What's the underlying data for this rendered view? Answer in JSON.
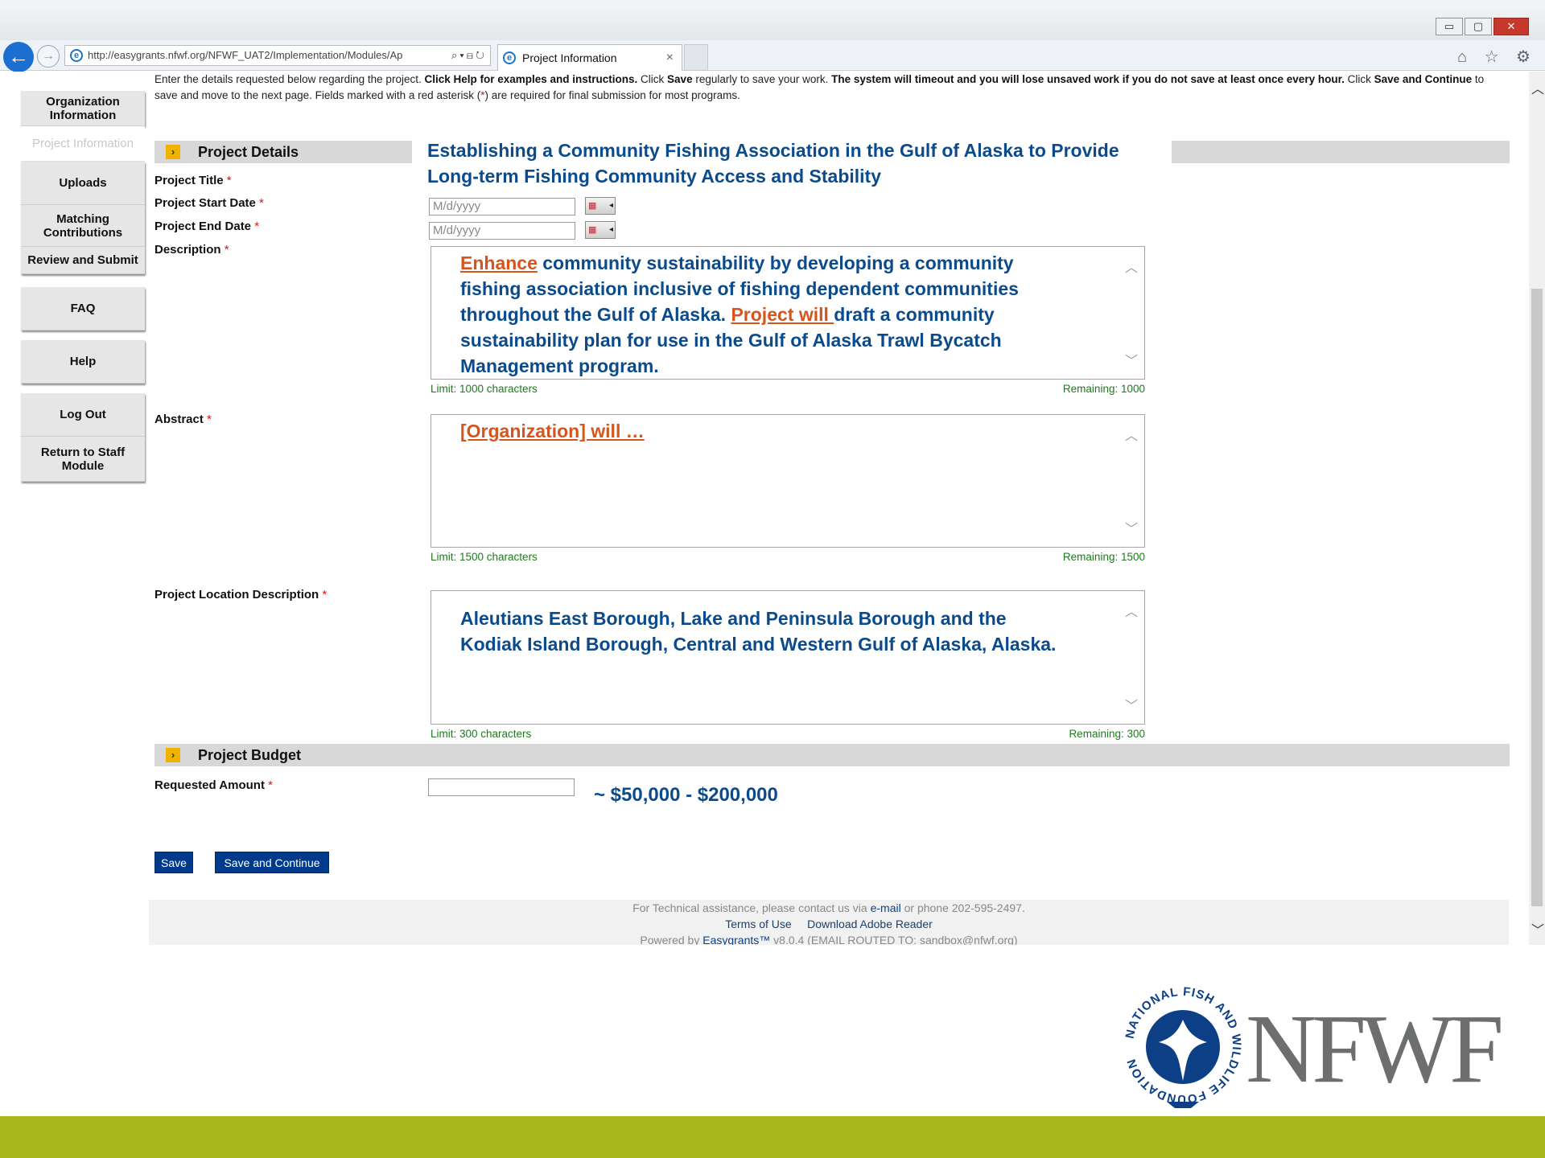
{
  "browser": {
    "url": "http://easygrants.nfwf.org/NFWF_UAT2/Implementation/Modules/Ap",
    "tab_label": "Project Information",
    "tab_close": "×",
    "window_buttons": [
      "▭",
      "▢",
      "✕"
    ],
    "toolbar_icons": "⌂ ☆ ⚙"
  },
  "sidebar": {
    "items": [
      {
        "label": "Organization Information"
      },
      {
        "label": "Project Information"
      },
      {
        "label": "Uploads"
      },
      {
        "label": "Matching Contributions"
      },
      {
        "label": "Review and Submit"
      },
      {
        "label": "FAQ"
      },
      {
        "label": "Help"
      },
      {
        "label": "Log Out"
      },
      {
        "label": "Return to Staff Module"
      }
    ]
  },
  "intro": {
    "p1": "Enter the details requested below regarding the project. ",
    "b1": "Click Help for examples and instructions.",
    "p2": " Click ",
    "b2": "Save",
    "p3": " regularly to save your work. ",
    "b3": "The system will timeout and you will lose unsaved work if you do not save at least once every hour.",
    "p4": " Click ",
    "b4": "Save and Continue",
    "p5": " to save and move to the next page. Fields marked with a red asterisk (",
    "ast": "*",
    "p6": ") are required for final submission for most programs."
  },
  "details": {
    "section_title": "Project Details",
    "title_label": "Project Title",
    "title_value": "Establishing a Community Fishing Association in the Gulf of Alaska to Provide Long-term Fishing Community Access and Stability",
    "start_label": "Project Start Date",
    "end_label": "Project End Date",
    "date_placeholder": "M/d/yyyy",
    "description_label": "Description",
    "description_orange1": "Enhance",
    "description_part1": " community sustainability by developing a community fishing association inclusive of fishing dependent communities throughout the Gulf of Alaska. ",
    "description_orange2": "Project will ",
    "description_part2": "draft a community sustainability plan for use in the Gulf of Alaska Trawl Bycatch Management program.",
    "description_limit": "Limit: 1000 characters",
    "description_remaining": "Remaining: 1000",
    "abstract_label": "Abstract",
    "abstract_value": "[Organization] will …",
    "abstract_limit": "Limit: 1500 characters",
    "abstract_remaining": "Remaining: 1500",
    "location_label": "Project Location Description",
    "location_value": "Aleutians East Borough, Lake and Peninsula Borough and the Kodiak Island Borough, Central and Western Gulf of Alaska, Alaska.",
    "location_limit": "Limit: 300 characters",
    "location_remaining": "Remaining: 300",
    "required_mark": "*"
  },
  "budget": {
    "section_title": "Project Budget",
    "amount_label": "Requested Amount",
    "amount_value": "",
    "amount_note": "~ $50,000 - $200,000"
  },
  "buttons": {
    "save": "Save",
    "save_continue": "Save and Continue"
  },
  "footer": {
    "assist_pre": "For Technical assistance, please contact us via ",
    "assist_link": "e-mail",
    "assist_post": " or phone 202-595-2497.",
    "terms": "Terms of Use",
    "adobe": "Download Adobe Reader",
    "powered_pre": "Powered by ",
    "powered_link": "Easygrants™",
    "powered_post": " v8.0.4 (EMAIL ROUTED TO: sandbox@nfwf.org)"
  },
  "logo": {
    "brand": "NFWF",
    "ring_text": "NATIONAL FISH AND WILDLIFE FOUNDATION"
  },
  "colors": {
    "accent_green": "#a9b61c",
    "form_blue": "#0b4b8c",
    "highlight_orange": "#d4551e",
    "button_blue": "#003a8c"
  }
}
